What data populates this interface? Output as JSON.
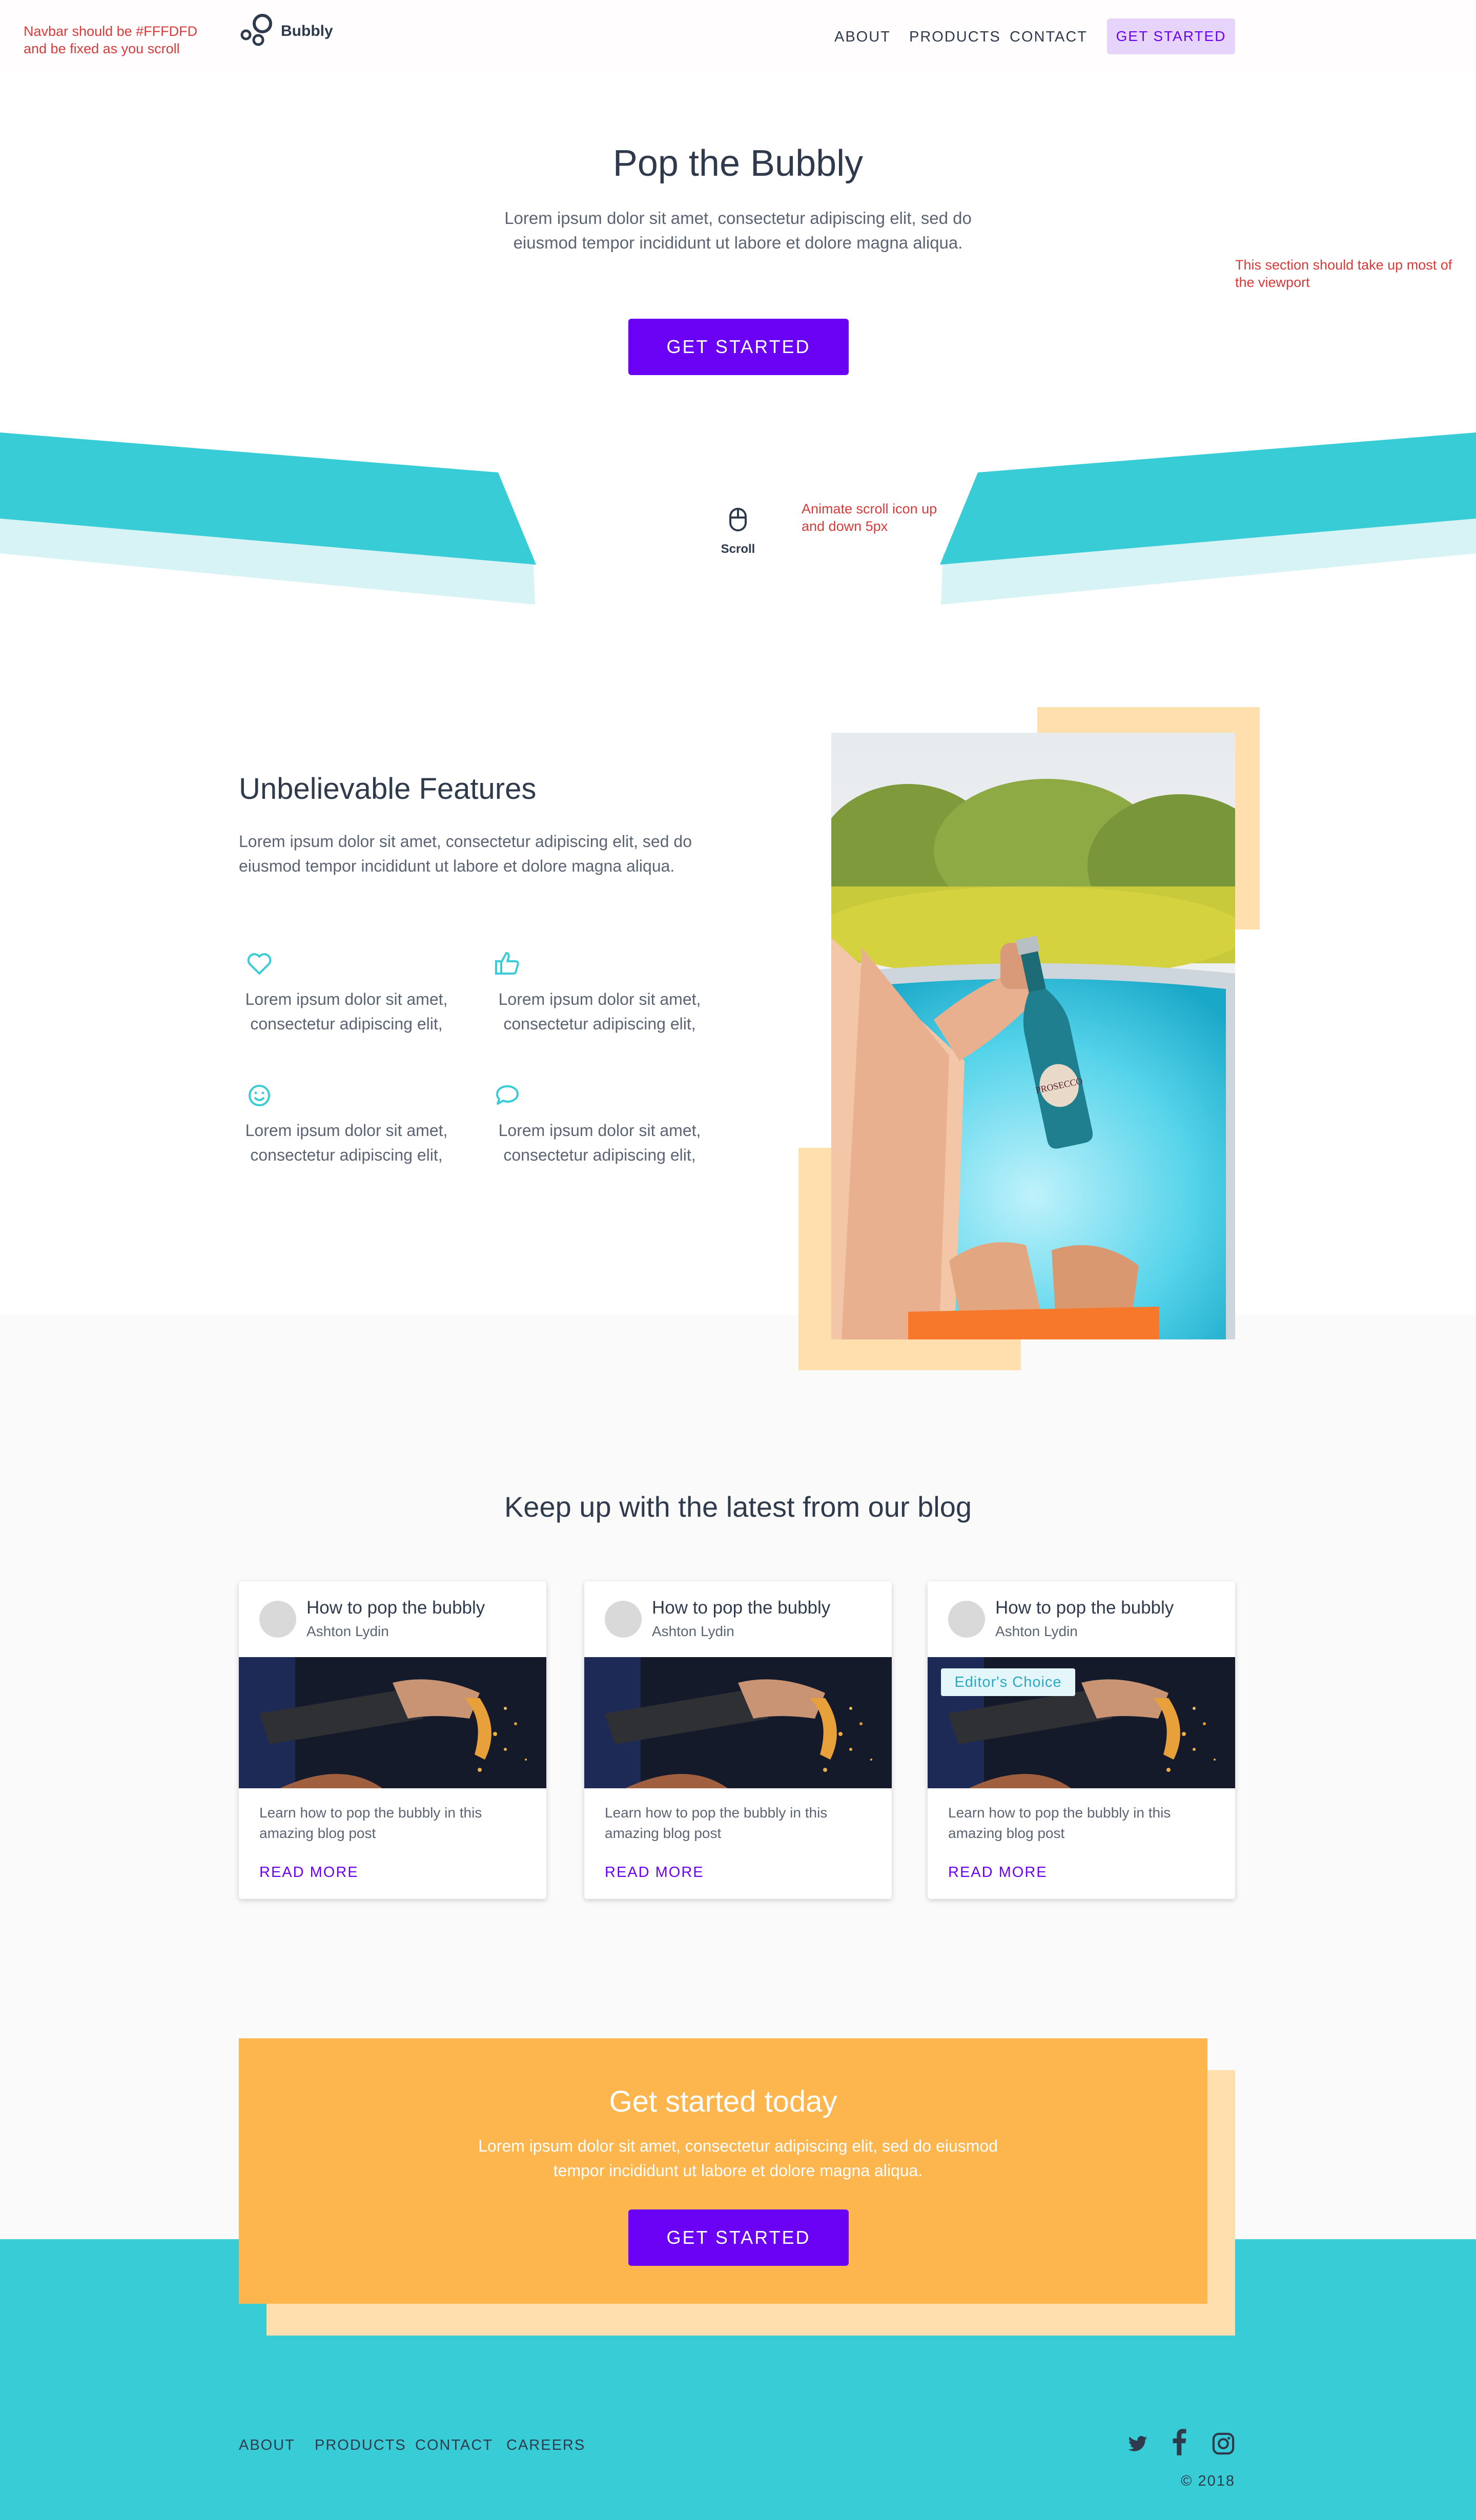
{
  "notes": {
    "navbar": "Navbar should be #FFFDFD and be fixed as you scroll",
    "hero": "This section should take up most of the viewport",
    "scroll": "Animate scroll icon up and down 5px"
  },
  "nav": {
    "logo": "Bubbly",
    "links": [
      "ABOUT",
      "PRODUCTS",
      "CONTACT"
    ],
    "cta": "GET STARTED"
  },
  "hero": {
    "title": "Pop the Bubbly",
    "subtitle": "Lorem ipsum dolor sit amet, consectetur adipiscing elit, sed do eiusmod tempor incididunt ut labore et dolore magna aliqua.",
    "cta": "GET STARTED",
    "scroll_label": "Scroll",
    "scroll_icon": "mouse-icon"
  },
  "features": {
    "title": "Unbelievable Features",
    "subtitle": "Lorem ipsum dolor sit amet, consectetur adipiscing elit, sed do eiusmod tempor incididunt ut labore et dolore magna aliqua.",
    "items": [
      {
        "icon": "heart-icon",
        "text": "Lorem ipsum dolor sit amet, consectetur adipiscing elit,"
      },
      {
        "icon": "thumbs-up-icon",
        "text": "Lorem ipsum dolor sit amet, consectetur adipiscing elit,"
      },
      {
        "icon": "smiley-icon",
        "text": "Lorem ipsum dolor sit amet, consectetur adipiscing elit,"
      },
      {
        "icon": "chat-bubble-icon",
        "text": "Lorem ipsum dolor sit amet, consectetur adipiscing elit,"
      }
    ],
    "image_label": "PROSECCO"
  },
  "blog": {
    "title": "Keep up with the latest from our blog",
    "posts": [
      {
        "title": "How to pop the bubbly",
        "author": "Ashton Lydin",
        "description": "Learn how to pop the bubbly in this amazing blog post",
        "read_more": "READ MORE",
        "badge": ""
      },
      {
        "title": "How to pop the bubbly",
        "author": "Ashton Lydin",
        "description": "Learn how to pop the bubbly in this amazing blog post",
        "read_more": "READ MORE",
        "badge": ""
      },
      {
        "title": "How to pop the bubbly",
        "author": "Ashton Lydin",
        "description": "Learn how to pop the bubbly in this amazing blog post",
        "read_more": "READ MORE",
        "badge": "Editor's Choice"
      }
    ]
  },
  "cta": {
    "title": "Get started today",
    "subtitle": "Lorem ipsum dolor sit amet, consectetur adipiscing elit, sed do eiusmod tempor incididunt ut labore et dolore magna aliqua.",
    "button": "GET STARTED"
  },
  "footer": {
    "links": [
      "ABOUT",
      "PRODUCTS",
      "CONTACT",
      "CAREERS"
    ],
    "social_icons": [
      "twitter-icon",
      "facebook-icon",
      "instagram-icon"
    ],
    "copyright": "© 2018"
  },
  "colors": {
    "primary": "#6a00f4",
    "teal": "#38cdd6",
    "orange": "#fdb54d",
    "peach": "#ffdfad",
    "navbar": "#fffdfd",
    "note": "#d83a3a"
  }
}
